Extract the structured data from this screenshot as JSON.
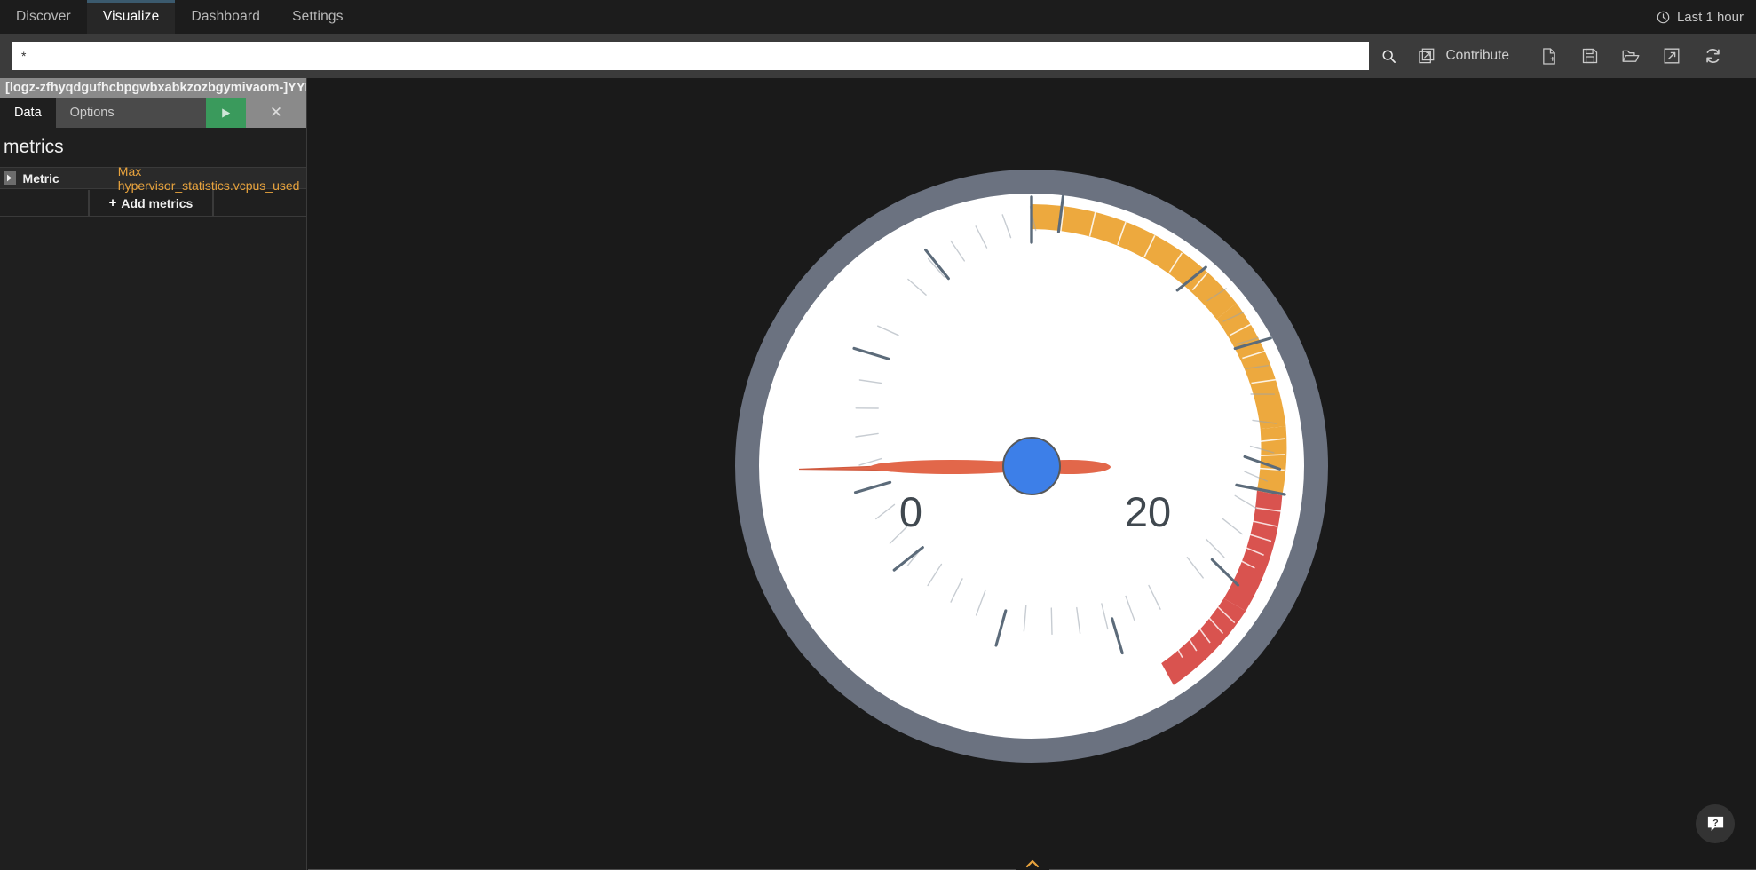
{
  "topnav": {
    "items": [
      {
        "label": "Discover",
        "active": false
      },
      {
        "label": "Visualize",
        "active": true
      },
      {
        "label": "Dashboard",
        "active": false
      },
      {
        "label": "Settings",
        "active": false
      }
    ],
    "timepicker": {
      "label": "Last 1 hour",
      "icon": "clock-icon"
    }
  },
  "querybar": {
    "query_value": "*",
    "query_placeholder": "",
    "search_icon": "search-icon",
    "contribute_label": "Contribute",
    "contribute_icon": "external-window-icon",
    "actions": [
      {
        "name": "new-visualization-button",
        "icon": "new-document-icon"
      },
      {
        "name": "save-visualization-button",
        "icon": "floppy-save-icon"
      },
      {
        "name": "open-visualization-button",
        "icon": "open-folder-icon"
      },
      {
        "name": "share-visualization-button",
        "icon": "external-link-icon"
      },
      {
        "name": "refresh-button",
        "icon": "refresh-icon"
      }
    ]
  },
  "sidebar": {
    "index_pattern": "[logz-zfhyqdgufhcbpgwbxabkzozbgymivaom-]YYMMDD",
    "tabs": [
      {
        "label": "Data",
        "active": true
      },
      {
        "label": "Options",
        "active": false
      }
    ],
    "apply_icon": "play-triangle-icon",
    "discard_icon": "close-x-icon",
    "section_title": "metrics",
    "metric": {
      "label": "Metric",
      "value": "Max hypervisor_statistics.vcpus_used",
      "caret_icon": "caret-right-icon"
    },
    "add_metrics_label": "Add metrics",
    "add_metrics_plus": "+"
  },
  "viz": {
    "footer_chevron_icon": "chevron-up-icon",
    "help_icon": "help-question-icon"
  },
  "colors": {
    "accent_orange": "#eda93e",
    "accent_red": "#d9534f",
    "needle": "#e2674a",
    "hub": "#3d7fe8",
    "bezel": "#6b7280",
    "face": "#ffffff",
    "apply_green": "#3a9a5c",
    "tick": "#5c6b7a"
  },
  "chart_data": {
    "type": "gauge",
    "title": "",
    "value": 0,
    "min": 0,
    "max": 40,
    "labeled_ticks": [
      {
        "value": 0,
        "label": "0"
      },
      {
        "value": 20,
        "label": "20"
      }
    ],
    "major_tick_step": 5,
    "minor_tick_step": 1,
    "start_angle_deg": 140,
    "end_angle_deg": 400,
    "needle_value": 0,
    "bands": [
      {
        "from": 20,
        "to": 32,
        "color": "#eda93e",
        "name": "warning"
      },
      {
        "from": 32,
        "to": 40,
        "color": "#d9534f",
        "name": "critical"
      }
    ],
    "metric_label": "Max hypervisor_statistics.vcpus_used",
    "ylabel": "",
    "xlabel": ""
  }
}
